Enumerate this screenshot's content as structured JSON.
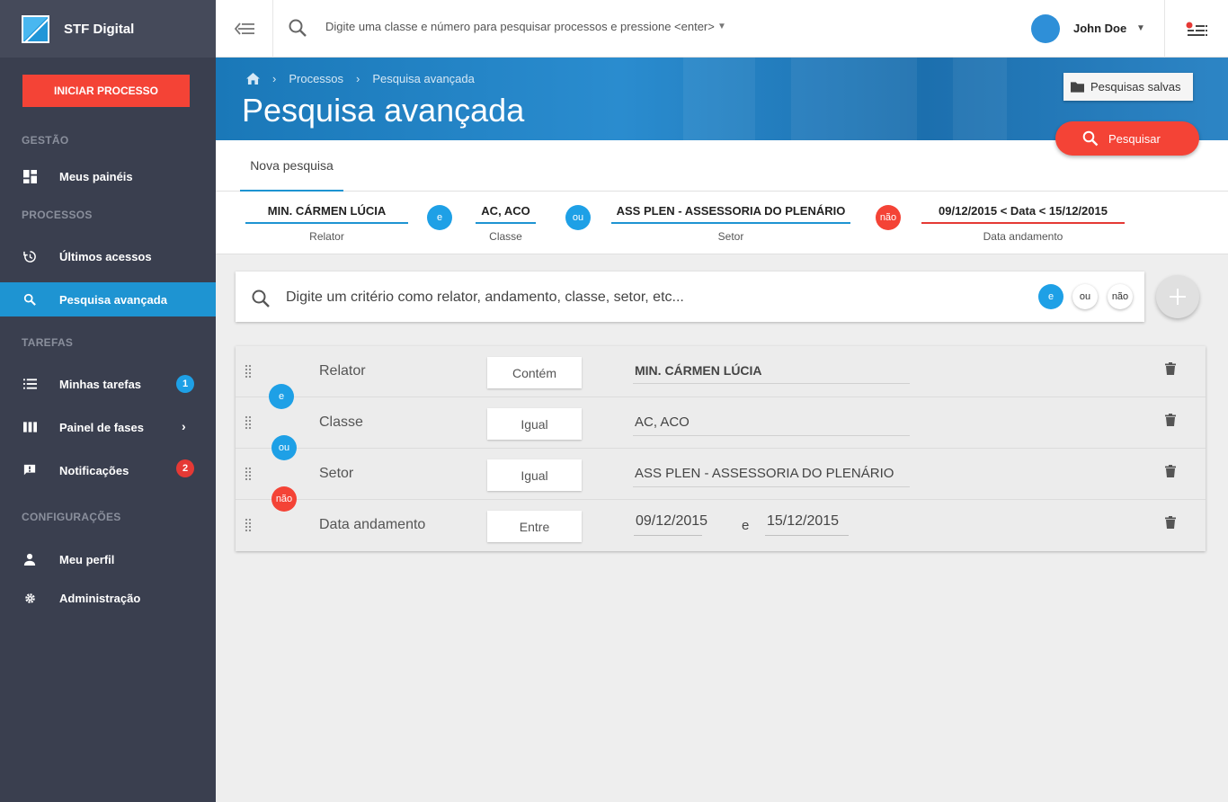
{
  "app": {
    "name": "STF Digital"
  },
  "sidebar": {
    "start_button": "INICIAR PROCESSO",
    "sections": {
      "gestao": "GESTÃO",
      "processos": "PROCESSOS",
      "tarefas": "TAREFAS",
      "configuracoes": "CONFIGURAÇÕES"
    },
    "items": {
      "meus_paineis": "Meus painéis",
      "ultimos_acessos": "Últimos acessos",
      "pesquisa_avancada": "Pesquisa avançada",
      "minhas_tarefas": "Minhas tarefas",
      "painel_fases": "Painel de fases",
      "notificacoes": "Notificações",
      "meu_perfil": "Meu perfil",
      "administracao": "Administração"
    },
    "badges": {
      "tarefas": "1",
      "notificacoes": "2"
    },
    "colors": {
      "active": "#1e94d2",
      "badge_blue": "#1ea0e6",
      "badge_red": "#e53935"
    }
  },
  "topbar": {
    "search_placeholder": "Digite uma classe e número para pesquisar processos e pressione <enter>",
    "user_name": "John Doe"
  },
  "header": {
    "breadcrumb": [
      "Processos",
      "Pesquisa avançada"
    ],
    "title": "Pesquisa avançada",
    "saved_searches": "Pesquisas salvas",
    "search_button": "Pesquisar"
  },
  "tabs": {
    "new_search": "Nova pesquisa"
  },
  "summary": {
    "chips": [
      {
        "value": "MIN. CÁRMEN LÚCIA",
        "caption": "Relator"
      },
      {
        "value": "AC, ACO",
        "caption": "Classe"
      },
      {
        "value": "ASS PLEN - ASSESSORIA DO PLENÁRIO",
        "caption": "Setor"
      },
      {
        "value": "09/12/2015 < Data < 15/12/2015",
        "caption": "Data andamento"
      }
    ],
    "operators": [
      "e",
      "ou",
      "não"
    ]
  },
  "criteria": {
    "placeholder": "Digite um critério como relator, andamento, classe, setor, etc...",
    "operators": [
      "e",
      "ou",
      "não"
    ]
  },
  "filters": [
    {
      "field": "Relator",
      "condition": "Contém",
      "value": "MIN. CÁRMEN LÚCIA",
      "operator": "e"
    },
    {
      "field": "Classe",
      "condition": "Igual",
      "value": "AC, ACO",
      "operator": "ou"
    },
    {
      "field": "Setor",
      "condition": "Igual",
      "value": "ASS PLEN - ASSESSORIA DO PLENÁRIO",
      "operator": "não"
    },
    {
      "field": "Data andamento",
      "condition": "Entre",
      "from": "09/12/2015",
      "connector": "e",
      "to": "15/12/2015"
    }
  ]
}
